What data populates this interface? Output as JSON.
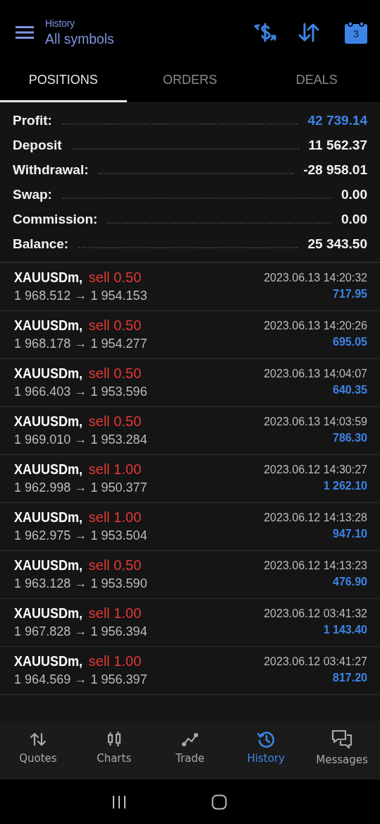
{
  "header": {
    "subtitle": "History",
    "title": "All symbols",
    "calendar_day": "3"
  },
  "tabs": [
    {
      "label": "POSITIONS",
      "selected": true
    },
    {
      "label": "ORDERS",
      "selected": false
    },
    {
      "label": "DEALS",
      "selected": false
    }
  ],
  "summary": [
    {
      "label": "Profit:",
      "value": "42 739.14",
      "highlight": true
    },
    {
      "label": "Deposit",
      "value": "11 562.37",
      "highlight": false
    },
    {
      "label": "Withdrawal:",
      "value": "-28 958.01",
      "highlight": false
    },
    {
      "label": "Swap:",
      "value": "0.00",
      "highlight": false
    },
    {
      "label": "Commission:",
      "value": "0.00",
      "highlight": false
    },
    {
      "label": "Balance:",
      "value": "25 343.50",
      "highlight": false
    }
  ],
  "positions": [
    {
      "symbol": "XAUUSDm,",
      "kind": "sell",
      "volume": "sell 0.50",
      "prices": "1 968.512 → 1 954.153",
      "time": "2023.06.13 14:20:32",
      "profit": "717.95"
    },
    {
      "symbol": "XAUUSDm,",
      "kind": "sell",
      "volume": "sell 0.50",
      "prices": "1 968.178 → 1 954.277",
      "time": "2023.06.13 14:20:26",
      "profit": "695.05"
    },
    {
      "symbol": "XAUUSDm,",
      "kind": "sell",
      "volume": "sell 0.50",
      "prices": "1 966.403 → 1 953.596",
      "time": "2023.06.13 14:04:07",
      "profit": "640.35"
    },
    {
      "symbol": "XAUUSDm,",
      "kind": "sell",
      "volume": "sell 0.50",
      "prices": "1 969.010 → 1 953.284",
      "time": "2023.06.13 14:03:59",
      "profit": "786.30"
    },
    {
      "symbol": "XAUUSDm,",
      "kind": "sell",
      "volume": "sell 1.00",
      "prices": "1 962.998 → 1 950.377",
      "time": "2023.06.12 14:30:27",
      "profit": "1 262.10"
    },
    {
      "symbol": "XAUUSDm,",
      "kind": "sell",
      "volume": "sell 1.00",
      "prices": "1 962.975 → 1 953.504",
      "time": "2023.06.12 14:13:28",
      "profit": "947.10"
    },
    {
      "symbol": "XAUUSDm,",
      "kind": "sell",
      "volume": "sell 0.50",
      "prices": "1 963.128 → 1 953.590",
      "time": "2023.06.12 14:13:23",
      "profit": "476.90"
    },
    {
      "symbol": "XAUUSDm,",
      "kind": "sell",
      "volume": "sell 1.00",
      "prices": "1 967.828 → 1 956.394",
      "time": "2023.06.12 03:41:32",
      "profit": "1 143.40"
    },
    {
      "symbol": "XAUUSDm,",
      "kind": "sell",
      "volume": "sell 1.00",
      "prices": "1 964.569 → 1 956.397",
      "time": "2023.06.12 03:41:27",
      "profit": "817.20"
    }
  ],
  "nav": [
    {
      "label": "Quotes",
      "selected": false
    },
    {
      "label": "Charts",
      "selected": false
    },
    {
      "label": "Trade",
      "selected": false
    },
    {
      "label": "History",
      "selected": true
    },
    {
      "label": "Messages",
      "selected": false
    }
  ]
}
